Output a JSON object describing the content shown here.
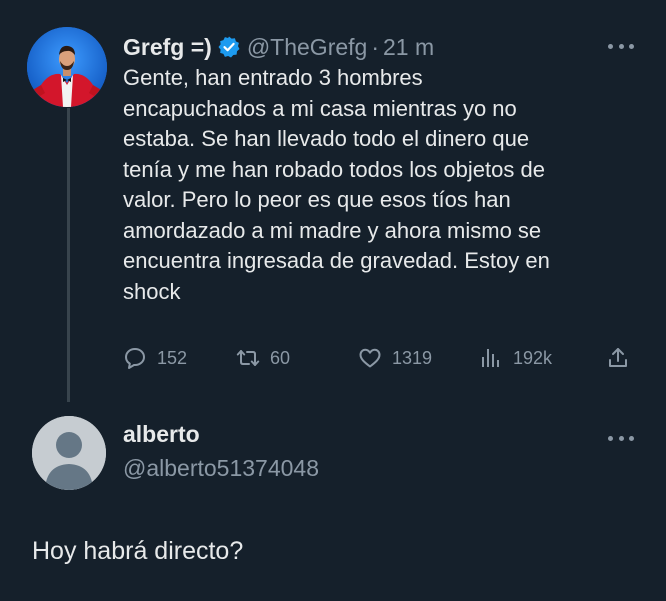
{
  "main_tweet": {
    "display_name": "Grefg =)",
    "verified": true,
    "handle": "@TheGrefg",
    "separator": "·",
    "time": "21 m",
    "text_lines": [
      "Gente, han entrado 3 hombres",
      "encapuchados a mi casa mientras yo no",
      "estaba. Se han llevado todo el dinero que",
      "tenía y me han robado todos los objetos de",
      "valor. Pero lo peor es que esos tíos han",
      "amordazado a mi madre y ahora mismo se",
      "encuentra ingresada de gravedad. Estoy en",
      "shock"
    ],
    "actions": {
      "replies": "152",
      "retweets": "60",
      "likes": "1319",
      "views": "192k"
    }
  },
  "reply": {
    "display_name": "alberto",
    "handle": "@alberto51374048",
    "text": "Hoy habrá directo?"
  },
  "colors": {
    "background": "#15202b",
    "text_primary": "#e7e9ea",
    "text_secondary": "#8b98a5",
    "verified_badge": "#1d9bf0",
    "thread_line": "#38444d"
  },
  "icons": {
    "reply": "reply-icon",
    "retweet": "retweet-icon",
    "like": "heart-icon",
    "views": "views-icon",
    "share": "share-icon",
    "more": "more-icon",
    "verified": "verified-badge-icon"
  }
}
